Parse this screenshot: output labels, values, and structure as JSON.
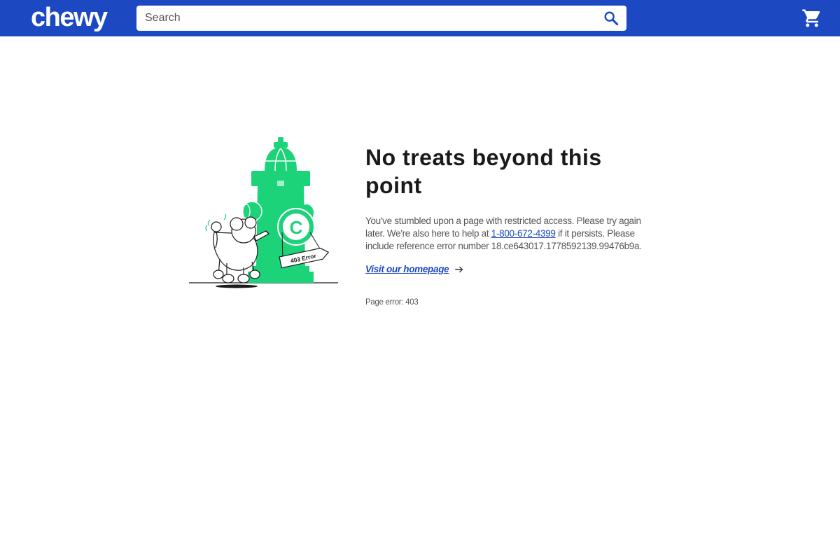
{
  "header": {
    "logo_text": "chewy",
    "search_placeholder": "Search",
    "search_icon": "search-icon",
    "cart_icon": "cart-icon",
    "brand_color": "#1c49c2"
  },
  "illustration": {
    "hydrant_letter": "C",
    "sign_text": "403 Error",
    "hydrant_color": "#1dd37a"
  },
  "main": {
    "title": "No treats beyond this point",
    "message_part1": "You've stumbled upon a page with restricted access. Please try again later. We're also here to help at ",
    "phone_link": "1-800-672-4399",
    "message_part2": " if it persists. Please include reference error number 18.ce643017.1778592139.99476b9a.",
    "homepage_link": "Visit our homepage",
    "page_error": "Page error: 403"
  }
}
